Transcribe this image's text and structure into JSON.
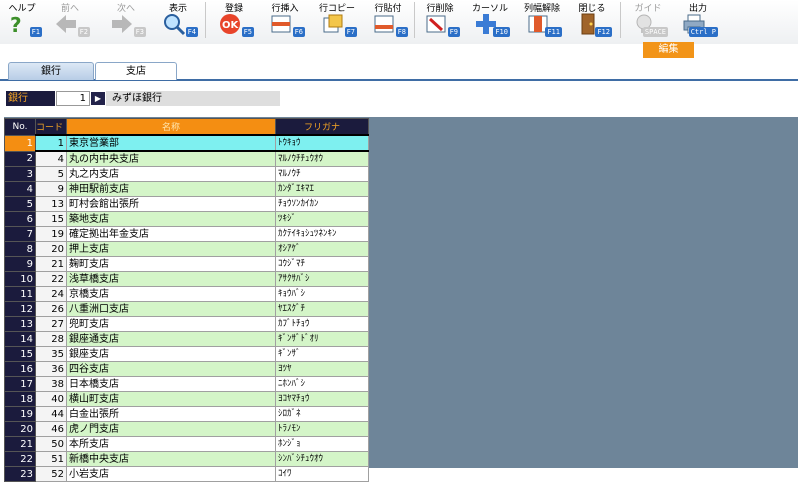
{
  "toolbar": {
    "buttons": [
      {
        "name": "help",
        "label": "ヘルプ",
        "key": "F1",
        "icon": "question-icon",
        "enabled": true
      },
      {
        "name": "prev",
        "label": "前へ",
        "key": "F2",
        "icon": "arrow-left-icon",
        "enabled": false
      },
      {
        "name": "next",
        "label": "次へ",
        "key": "F3",
        "icon": "arrow-right-icon",
        "enabled": false
      },
      {
        "name": "display",
        "label": "表示",
        "key": "F4",
        "icon": "magnifier-icon",
        "enabled": true
      },
      {
        "name": "register",
        "label": "登録",
        "key": "F5",
        "icon": "ok-icon",
        "enabled": true
      },
      {
        "name": "row-insert",
        "label": "行挿入",
        "key": "F6",
        "icon": "row-insert-icon",
        "enabled": true
      },
      {
        "name": "row-copy",
        "label": "行コピー",
        "key": "F7",
        "icon": "row-copy-icon",
        "enabled": true
      },
      {
        "name": "row-paste",
        "label": "行貼付",
        "key": "F8",
        "icon": "row-paste-icon",
        "enabled": true
      },
      {
        "name": "row-delete",
        "label": "行削除",
        "key": "F9",
        "icon": "row-delete-icon",
        "enabled": true
      },
      {
        "name": "cursor",
        "label": "カーソル",
        "key": "F10",
        "icon": "cursor-icon",
        "enabled": true
      },
      {
        "name": "column-release",
        "label": "列幅解除",
        "key": "F11",
        "icon": "column-release-icon",
        "enabled": true
      },
      {
        "name": "close",
        "label": "閉じる",
        "key": "F12",
        "icon": "door-icon",
        "enabled": true
      },
      {
        "name": "guide",
        "label": "ガイド",
        "key": "SPACE",
        "icon": "bulb-icon",
        "enabled": false
      },
      {
        "name": "output",
        "label": "出力",
        "key": "Ctrl P",
        "icon": "printer-icon",
        "enabled": true
      }
    ],
    "mode_badge": "編集"
  },
  "tabs": [
    {
      "label": "銀行",
      "active": false
    },
    {
      "label": "支店",
      "active": true
    }
  ],
  "filter": {
    "bank_label": "銀行",
    "bank_code": "1",
    "lookup_symbol": "▶",
    "bank_name": "みずほ銀行"
  },
  "grid": {
    "headers": {
      "no": "No.",
      "code": "コード",
      "name": "名称",
      "kana": "フリガナ"
    },
    "selected_row": 1,
    "rows": [
      {
        "no": "1",
        "code": "1",
        "name": "東京営業部",
        "kana": "ﾄｳｷｮｳ"
      },
      {
        "no": "2",
        "code": "4",
        "name": "丸の内中央支店",
        "kana": "ﾏﾙﾉｳﾁﾁｭｳｵｳ"
      },
      {
        "no": "3",
        "code": "5",
        "name": "丸之内支店",
        "kana": "ﾏﾙﾉｳﾁ"
      },
      {
        "no": "4",
        "code": "9",
        "name": "神田駅前支店",
        "kana": "ｶﾝﾀﾞｴｷﾏｴ"
      },
      {
        "no": "5",
        "code": "13",
        "name": "町村会館出張所",
        "kana": "ﾁｮｳｿﾝｶｲｶﾝ"
      },
      {
        "no": "6",
        "code": "15",
        "name": "築地支店",
        "kana": "ﾂｷｼﾞ"
      },
      {
        "no": "7",
        "code": "19",
        "name": "確定拠出年金支店",
        "kana": "ｶｸﾃｲｷｮｼｭﾂﾈﾝｷﾝ"
      },
      {
        "no": "8",
        "code": "20",
        "name": "押上支店",
        "kana": "ｵｼｱｹﾞ"
      },
      {
        "no": "9",
        "code": "21",
        "name": "麹町支店",
        "kana": "ｺｳｼﾞﾏﾁ"
      },
      {
        "no": "10",
        "code": "22",
        "name": "浅草橋支店",
        "kana": "ｱｻｸｻﾊﾞｼ"
      },
      {
        "no": "11",
        "code": "24",
        "name": "京橋支店",
        "kana": "ｷｮｳﾊﾞｼ"
      },
      {
        "no": "12",
        "code": "26",
        "name": "八重洲口支店",
        "kana": "ﾔｴｽｸﾞﾁ"
      },
      {
        "no": "13",
        "code": "27",
        "name": "兜町支店",
        "kana": "ｶﾌﾞﾄﾁｮｳ"
      },
      {
        "no": "14",
        "code": "28",
        "name": "銀座通支店",
        "kana": "ｷﾞﾝｻﾞﾄﾞｵﾘ"
      },
      {
        "no": "15",
        "code": "35",
        "name": "銀座支店",
        "kana": "ｷﾞﾝｻﾞ"
      },
      {
        "no": "16",
        "code": "36",
        "name": "四谷支店",
        "kana": "ﾖﾂﾔ"
      },
      {
        "no": "17",
        "code": "38",
        "name": "日本橋支店",
        "kana": "ﾆﾎﾝﾊﾞｼ"
      },
      {
        "no": "18",
        "code": "40",
        "name": "横山町支店",
        "kana": "ﾖｺﾔﾏﾁｮｳ"
      },
      {
        "no": "19",
        "code": "44",
        "name": "白金出張所",
        "kana": "ｼﾛｶﾞﾈ"
      },
      {
        "no": "20",
        "code": "46",
        "name": "虎ノ門支店",
        "kana": "ﾄﾗﾉﾓﾝ"
      },
      {
        "no": "21",
        "code": "50",
        "name": "本所支店",
        "kana": "ﾎﾝｼﾞｮ"
      },
      {
        "no": "22",
        "code": "51",
        "name": "新橋中央支店",
        "kana": "ｼﾝﾊﾞｼﾁｭｳｵｳ"
      },
      {
        "no": "23",
        "code": "52",
        "name": "小岩支店",
        "kana": "ｺｲﾜ"
      }
    ]
  }
}
